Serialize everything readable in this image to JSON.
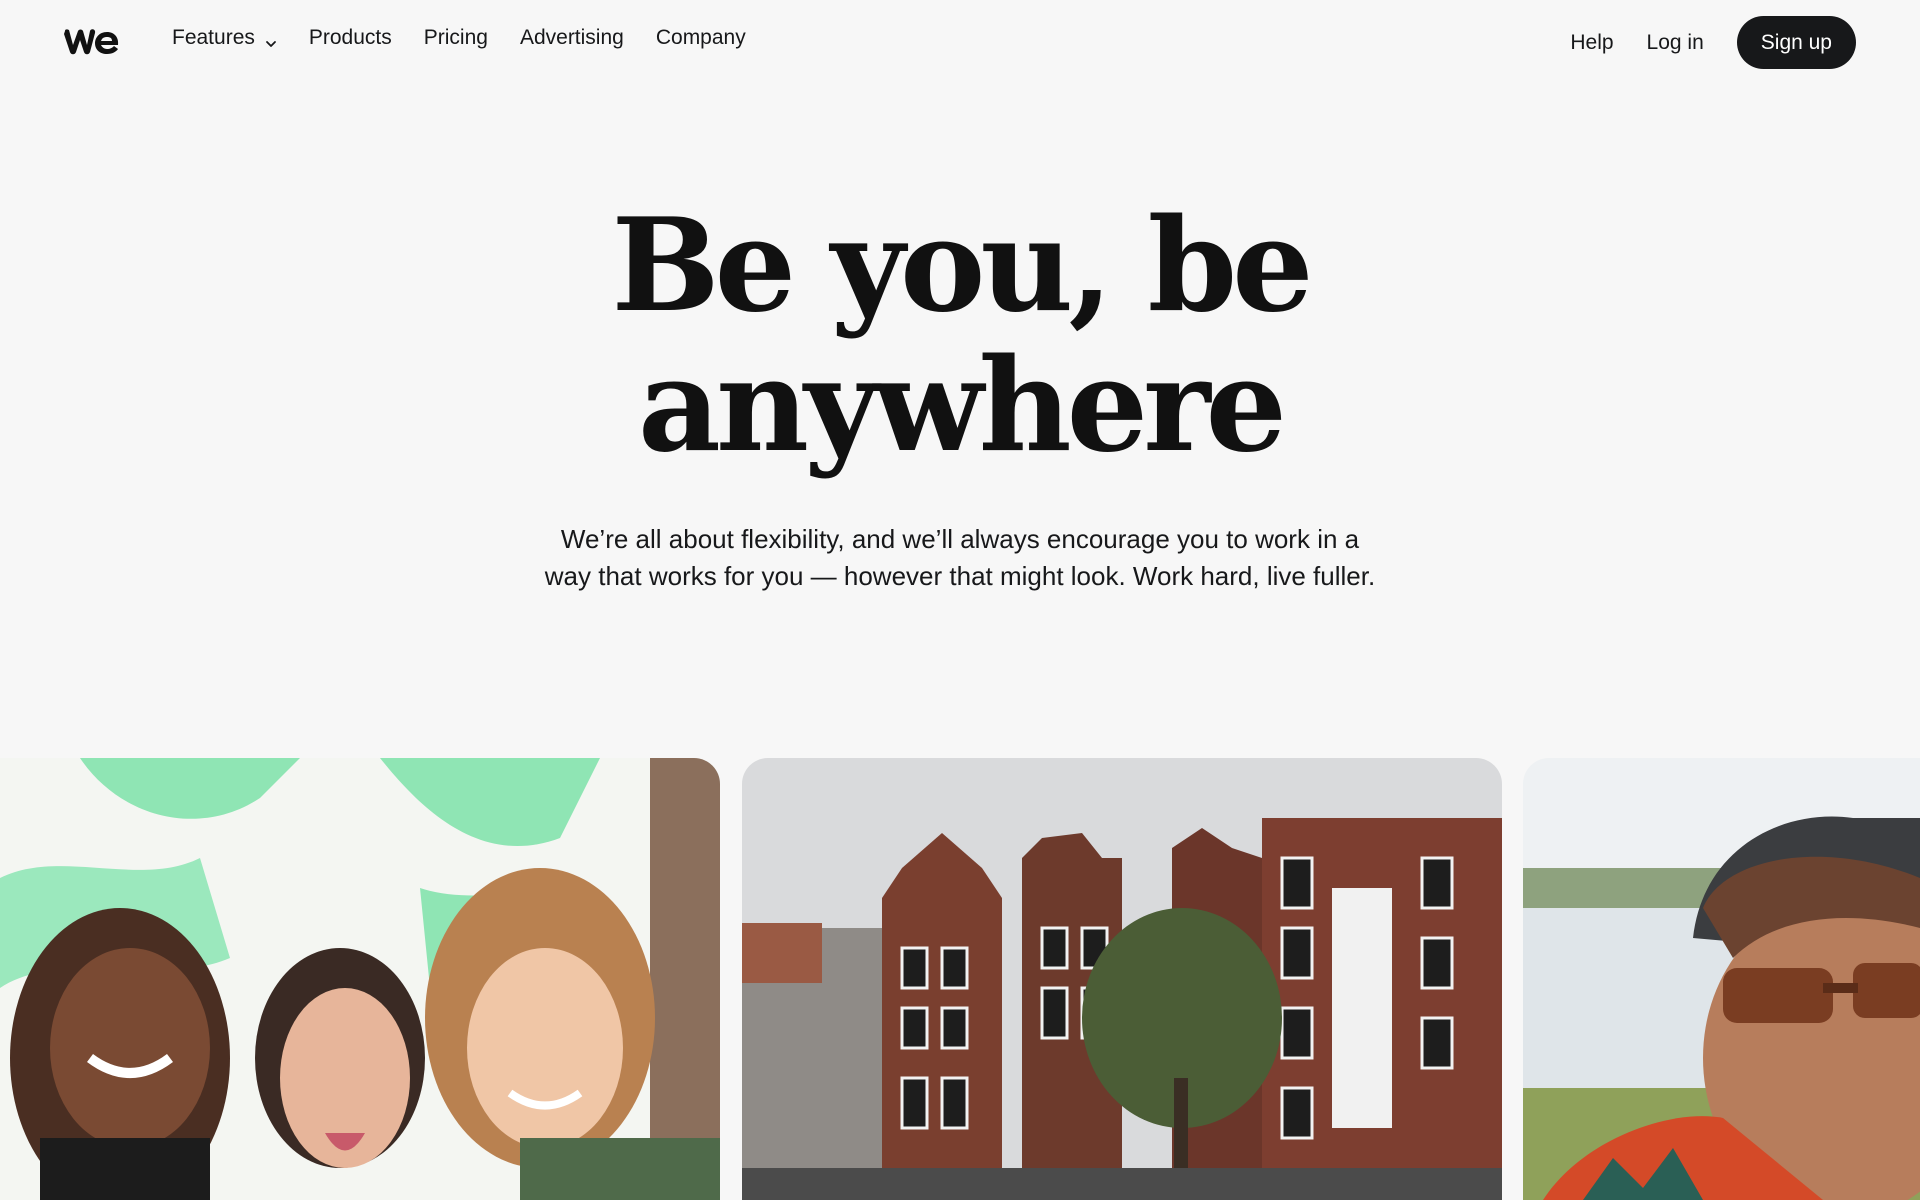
{
  "brand": {
    "logo_text": "we"
  },
  "nav": {
    "features": "Features",
    "products": "Products",
    "pricing": "Pricing",
    "advertising": "Advertising",
    "company": "Company",
    "help": "Help",
    "login": "Log in",
    "signup": "Sign up"
  },
  "hero": {
    "title_line1": "Be you, be",
    "title_line2": "anywhere",
    "subtitle_line1": "We’re all about flexibility, and we’ll always encourage you to work in a",
    "subtitle_line2": "way that works for you — however that might look. Work hard, live fuller."
  },
  "colors": {
    "background": "#f7f7f7",
    "text": "#17181a",
    "button_bg": "#17181a",
    "accent_green": "#8fe5b4"
  },
  "icons": [
    "logo-icon",
    "chevron-down-icon"
  ]
}
